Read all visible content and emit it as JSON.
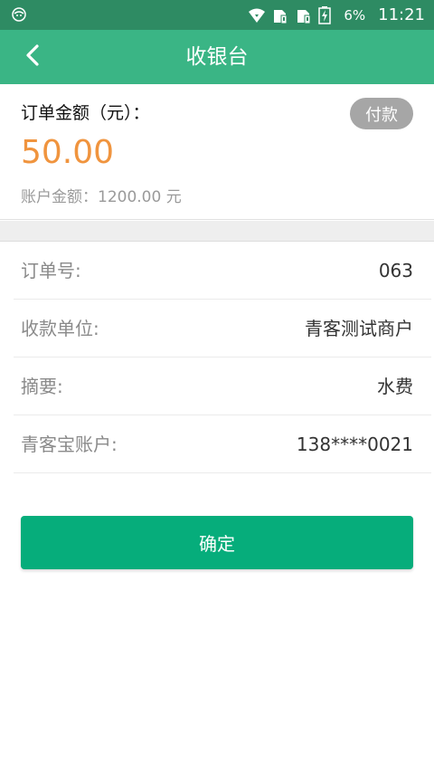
{
  "status_bar": {
    "battery_pct": "6%",
    "clock": "11:21",
    "icons": [
      "android-icon",
      "wifi-icon",
      "sim1-icon",
      "sim2-icon",
      "battery-charging-icon"
    ]
  },
  "app_bar": {
    "title": "收银台",
    "back_icon": "chevron-left-icon"
  },
  "summary": {
    "label": "订单金额（元）：",
    "pay_button": "付款",
    "amount": "50.00",
    "balance_label": "账户金额：",
    "balance_value": "1200.00 元"
  },
  "details": {
    "rows": [
      {
        "key": "订单号:",
        "value": "063"
      },
      {
        "key": "收款单位:",
        "value": "青客测试商户"
      },
      {
        "key": "摘要:",
        "value": "水费"
      },
      {
        "key": "青客宝账户:",
        "value": "138****0021"
      }
    ]
  },
  "confirm_button": "确定",
  "colors": {
    "status_bar": "#2e8b63",
    "app_bar": "#3ab585",
    "amount": "#f0943e",
    "confirm": "#06ad7b",
    "pay_button": "#a6a6a6"
  }
}
